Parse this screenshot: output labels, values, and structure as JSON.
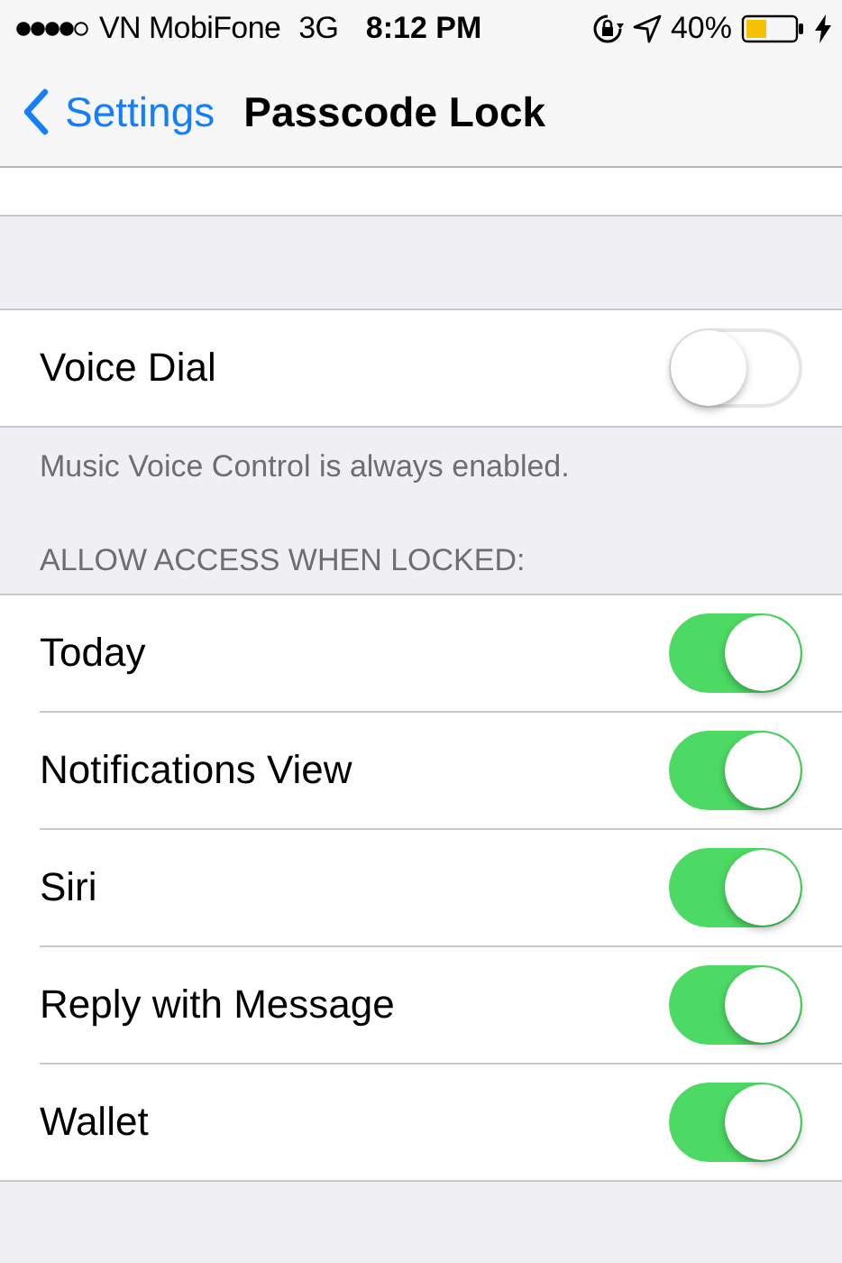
{
  "status_bar": {
    "carrier": "VN MobiFone",
    "network": "3G",
    "time": "8:12 PM",
    "battery": "40%"
  },
  "nav": {
    "back": "Settings",
    "title": "Passcode Lock"
  },
  "voice_dial": {
    "label": "Voice Dial",
    "on": false
  },
  "voice_footer": "Music Voice Control is always enabled.",
  "section_header": "ALLOW ACCESS WHEN LOCKED:",
  "items": [
    {
      "label": "Today",
      "on": true
    },
    {
      "label": "Notifications View",
      "on": true
    },
    {
      "label": "Siri",
      "on": true
    },
    {
      "label": "Reply with Message",
      "on": true
    },
    {
      "label": "Wallet",
      "on": true
    }
  ]
}
